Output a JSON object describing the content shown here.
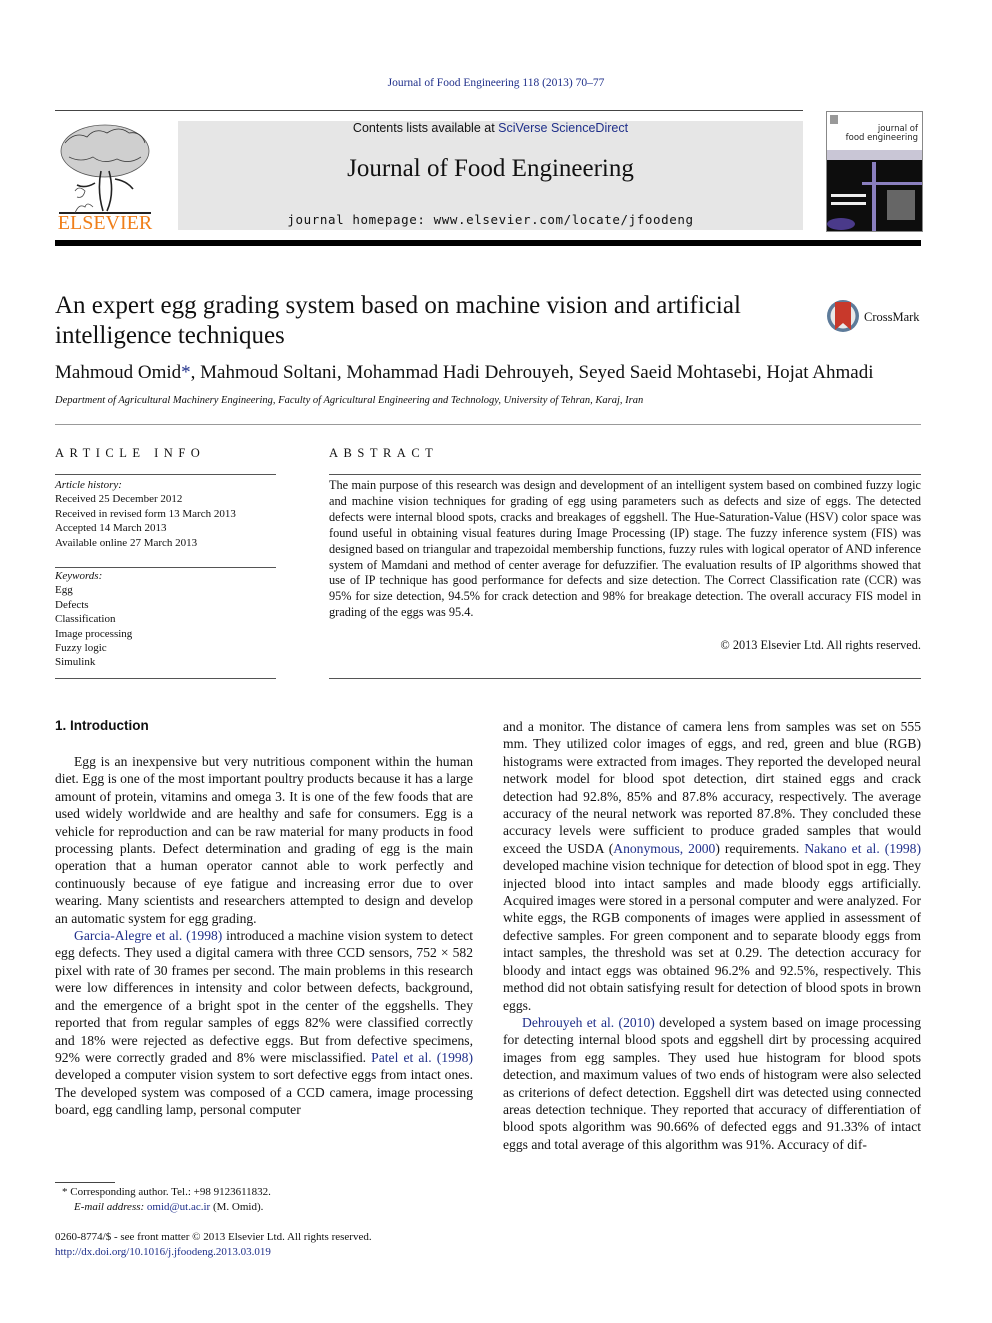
{
  "header": {
    "citation": "Journal of Food Engineering 118 (2013) 70–77",
    "contents_prefix": "Contents lists available at ",
    "contents_link": "SciVerse ScienceDirect",
    "journal_title": "Journal of Food Engineering",
    "homepage": "journal homepage: www.elsevier.com/locate/jfoodeng",
    "publisher_logo_text": "ELSEVIER",
    "cover_title_line1": "journal of",
    "cover_title_line2": "food engineering",
    "colors": {
      "elsevier_orange": "#f07f1a",
      "link_blue": "#1f2f8a",
      "banner_gray": "#e6e6e6"
    }
  },
  "article": {
    "title": "An expert egg grading system based on machine vision and artificial intelligence techniques",
    "crossmark_label": "CrossMark",
    "authors": [
      {
        "name": "Mahmoud Omid",
        "mark": "*"
      },
      {
        "name": "Mahmoud Soltani",
        "mark": ""
      },
      {
        "name": "Mohammad Hadi Dehrouyeh",
        "mark": ""
      },
      {
        "name": "Seyed Saeid Mohtasebi",
        "mark": ""
      },
      {
        "name": "Hojat Ahmadi",
        "mark": ""
      }
    ],
    "affiliation": "Department of Agricultural Machinery Engineering, Faculty of Agricultural Engineering and Technology, University of Tehran, Karaj, Iran"
  },
  "article_info": {
    "heading": "ARTICLE INFO",
    "history_label": "Article history:",
    "history": [
      "Received 25 December 2012",
      "Received in revised form 13 March 2013",
      "Accepted 14 March 2013",
      "Available online 27 March 2013"
    ],
    "keywords_label": "Keywords:",
    "keywords": [
      "Egg",
      "Defects",
      "Classification",
      "Image processing",
      "Fuzzy logic",
      "Simulink"
    ]
  },
  "abstract": {
    "heading": "ABSTRACT",
    "text": "The main purpose of this research was design and development of an intelligent system based on combined fuzzy logic and machine vision techniques for grading of egg using parameters such as defects and size of eggs. The detected defects were internal blood spots, cracks and breakages of eggshell. The Hue-Saturation-Value (HSV) color space was found useful in obtaining visual features during Image Processing (IP) stage. The fuzzy inference system (FIS) was designed based on triangular and trapezoidal membership functions, fuzzy rules with logical operator of AND inference system of Mamdani and method of center average for defuzzifier. The evaluation results of IP algorithms showed that use of IP technique has good performance for defects and size detection. The Correct Classification rate (CCR) was 95% for size detection, 94.5% for crack detection and 98% for breakage detection. The overall accuracy FIS model in grading of the eggs was 95.4.",
    "copyright": "© 2013 Elsevier Ltd. All rights reserved."
  },
  "body": {
    "section_heading": "1. Introduction",
    "p1": "Egg is an inexpensive but very nutritious component within the human diet. Egg is one of the most important poultry products because it has a large amount of protein, vitamins and omega 3. It is one of the few foods that are used widely worldwide and are healthy and safe for consumers. Egg is a vehicle for reproduction and can be raw material for many products in food processing plants. Defect determination and grading of egg is the main operation that a human operator cannot able to work perfectly and continuously because of eye fatigue and increasing error due to over wearing. Many scientists and researchers attempted to design and develop an automatic system for egg grading.",
    "p2_ref1": "Garcia-Alegre et al. (1998)",
    "p2_a": " introduced a machine vision system to detect egg defects. They used a digital camera with three CCD sensors, 752 × 582 pixel with rate of 30 frames per second. The main problems in this research were low differences in intensity and color between defects, background, and the emergence of a bright spot in the center of the eggshells. They reported that from regular samples of eggs 82% were classified correctly and 18% were rejected as defective eggs. But from defective specimens, 92% were correctly graded and 8% were misclassified. ",
    "p2_ref2": "Patel et al. (1998)",
    "p2_b": " developed a computer vision system to sort defective eggs from intact ones. The developed system was composed of a CCD camera, image processing board, egg candling lamp, personal computer",
    "r1_a": "and a monitor. The distance of camera lens from samples was set on 555 mm. They utilized color images of eggs, and red, green and blue (RGB) histograms were extracted from images. They reported the developed neural network model for blood spot detection, dirt stained eggs and crack detection had 92.8%, 85% and 87.8% accuracy, respectively. The average accuracy of the neural network was reported 87.8%. They concluded these accuracy levels were sufficient to produce graded samples that would exceed the USDA (",
    "r1_ref1": "Anonymous, 2000",
    "r1_b": ") requirements. ",
    "r1_ref2": "Nakano et al. (1998)",
    "r1_c": " developed machine vision technique for detection of blood spot in egg. They injected blood into intact samples and made bloody eggs artificially. Acquired images were stored in a personal computer and were analyzed. For white eggs, the RGB components of images were applied in assessment of defective samples. For green component and to separate bloody eggs from intact samples, the threshold was set at 0.29. The detection accuracy for bloody and intact eggs was obtained 96.2% and 92.5%, respectively. This method did not obtain satisfying result for detection of blood spots in brown eggs.",
    "r2_ref": "Dehrouyeh et al. (2010)",
    "r2_a": " developed a system based on image processing for detecting internal blood spots and eggshell dirt by processing acquired images from egg samples. They used hue histogram for blood spots detection, and maximum values of two ends of histogram were also selected as criterions of defect detection. Eggshell dirt was detected using connected areas detection technique. They reported that accuracy of differentiation of blood spots algorithm was 90.66% of defected eggs and 91.33% of intact eggs and total average of this algorithm was 91%. Accuracy of dif-"
  },
  "footnotes": {
    "star": "*",
    "corresponding": "Corresponding author. Tel.: +98 9123611832.",
    "email_label": "E-mail address: ",
    "email": "omid@ut.ac.ir",
    "email_suffix": " (M. Omid).",
    "front_matter": "0260-8774/$ - see front matter © 2013 Elsevier Ltd. All rights reserved.",
    "doi": "http://dx.doi.org/10.1016/j.jfoodeng.2013.03.019"
  }
}
